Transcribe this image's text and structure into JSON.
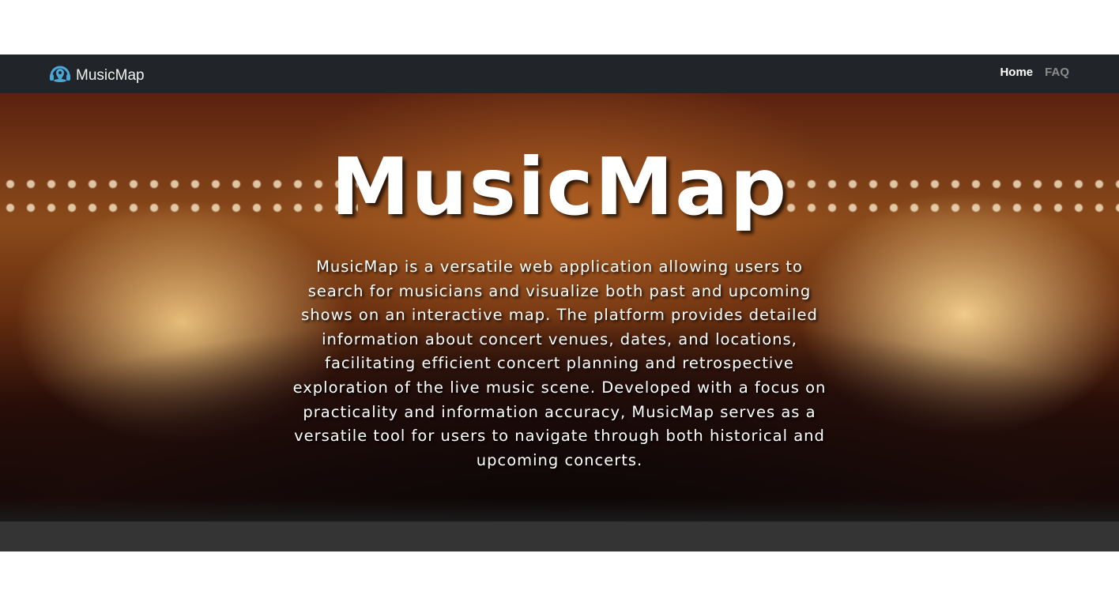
{
  "navbar": {
    "brand": "MusicMap",
    "brand_icon": "map-pin-headphones-icon",
    "links": [
      {
        "label": "Home"
      },
      {
        "label": "FAQ"
      }
    ]
  },
  "hero": {
    "title": "MusicMap",
    "description": "MusicMap is a versatile web application allowing users to search for musicians and visualize both past and upcoming shows on an interactive map. The platform provides detailed information about concert venues, dates, and locations, facilitating efficient concert planning and retrospective exploration of the live music scene. Developed with a focus on practicality and information accuracy, MusicMap serves as a versatile tool for users to navigate through both historical and upcoming concerts."
  },
  "colors": {
    "navbar": "#212529",
    "brand_icon": "#4aa8d8",
    "band": "#343434"
  }
}
